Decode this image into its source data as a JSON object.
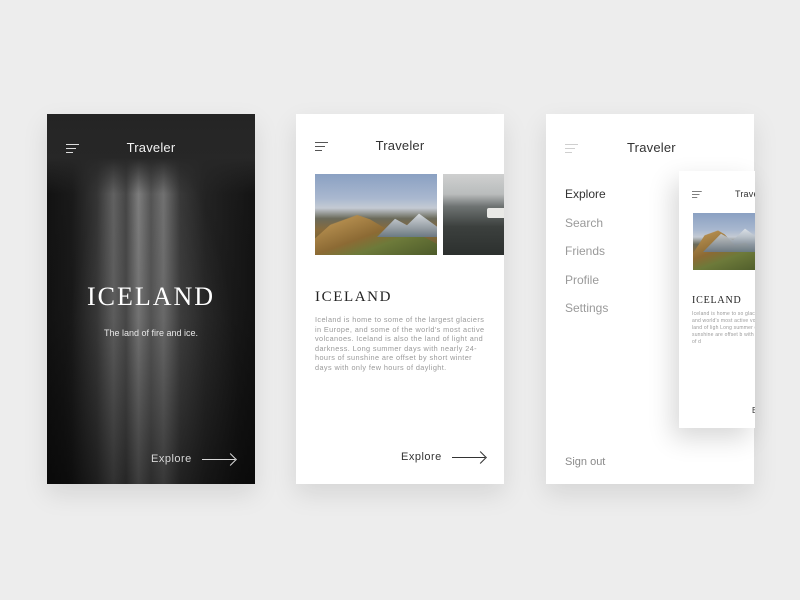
{
  "screens": {
    "home": {
      "app_title": "Traveler",
      "hero_title": "ICELAND",
      "hero_subtitle": "The land of fire and ice.",
      "explore_label": "Explore",
      "background_image": "waterfall",
      "icons": {
        "menu": "hamburger-menu-icon",
        "arrow": "arrow-right-icon"
      }
    },
    "article": {
      "app_title": "Traveler",
      "gallery": [
        "mountain-landscape-photo",
        "car-on-road-photo"
      ],
      "title": "ICELAND",
      "body": "Iceland is home to some of the largest glaciers in Europe, and some of the world's most active volcanoes. Iceland is also the land of light and darkness. Long summer days with nearly 24-hours of sunshine are offset by short winter days with only few hours of daylight.",
      "explore_label": "Explore"
    },
    "menu": {
      "app_title": "Traveler",
      "items": [
        {
          "label": "Explore",
          "active": true
        },
        {
          "label": "Search",
          "active": false
        },
        {
          "label": "Friends",
          "active": false
        },
        {
          "label": "Profile",
          "active": false
        },
        {
          "label": "Settings",
          "active": false
        }
      ],
      "signout_label": "Sign out",
      "preview": {
        "app_title": "Trave",
        "title": "ICELAND",
        "body": "Iceland is home to so glaciers in Europe, and world's most active vo is also the land of ligh Long summer days with of sunshine are offset b with only few hours of d",
        "explore_label": "E"
      }
    }
  },
  "colors": {
    "page_background": "#ededed",
    "card_background": "#ffffff",
    "dark_screen": "#1e1e1e",
    "text_dark": "#333333",
    "text_muted": "#9a9a9a"
  }
}
